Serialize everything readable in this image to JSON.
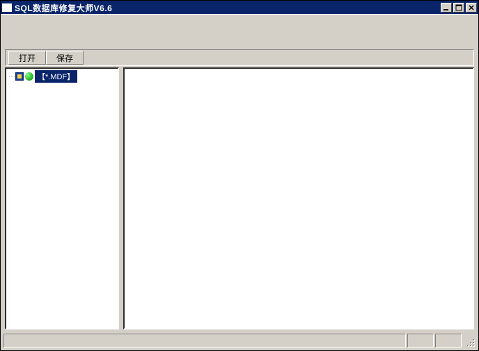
{
  "title": "SQL数据库修复大师V6.6",
  "toolbar": {
    "open_label": "打开",
    "save_label": "保存"
  },
  "tree": {
    "root_label": "【*.MDF】"
  }
}
